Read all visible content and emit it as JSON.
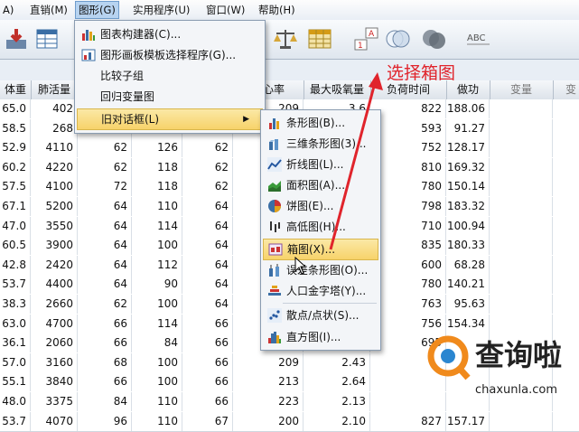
{
  "menubar": {
    "items": [
      "A)",
      "直销(M)",
      "图形(G)",
      "实用程序(U)",
      "窗口(W)",
      "帮助(H)"
    ]
  },
  "toolbar": {
    "icons": [
      "import-data-icon",
      "spreadsheet-icon",
      "scale-icon",
      "grid-icon",
      "vector-icon",
      "circles-icon",
      "circles-dark-icon",
      "abc-icon"
    ]
  },
  "graph_menu": {
    "items": [
      "图表构建器(C)...",
      "图形画板模板选择程序(G)...",
      "比较子组",
      "回归变量图",
      "旧对话框(L)"
    ]
  },
  "legacy_submenu": {
    "items": [
      "条形图(B)...",
      "三维条形图(3)...",
      "折线图(L)...",
      "面积图(A)...",
      "饼图(E)...",
      "高低图(H)...",
      "箱图(X)...",
      "误差条形图(O)...",
      "人口金字塔(Y)...",
      "散点/点状(S)...",
      "直方图(I)..."
    ]
  },
  "grid": {
    "headers": [
      "体重",
      "肺活量",
      "",
      "",
      "",
      "大心率",
      "最大吸氧量",
      "负荷时间",
      "做功",
      "变量",
      "变"
    ],
    "rows": [
      [
        "65.0",
        "402",
        "",
        "",
        "",
        "209",
        "3.6",
        "822",
        "188.06"
      ],
      [
        "58.5",
        "268",
        "",
        "",
        "",
        "",
        "",
        "593",
        "91.27"
      ],
      [
        "52.9",
        "4110",
        "62",
        "126",
        "62",
        "",
        "",
        "752",
        "128.17"
      ],
      [
        "60.2",
        "4220",
        "62",
        "118",
        "62",
        "",
        "",
        "810",
        "169.32"
      ],
      [
        "57.5",
        "4100",
        "72",
        "118",
        "62",
        "",
        "",
        "780",
        "150.14"
      ],
      [
        "67.1",
        "5200",
        "64",
        "110",
        "64",
        "",
        "",
        "798",
        "183.32"
      ],
      [
        "47.0",
        "3550",
        "64",
        "114",
        "64",
        "",
        "",
        "710",
        "100.94"
      ],
      [
        "60.5",
        "3900",
        "64",
        "100",
        "64",
        "",
        "",
        "835",
        "180.33"
      ],
      [
        "42.8",
        "2420",
        "64",
        "112",
        "64",
        "",
        "",
        "600",
        "68.28"
      ],
      [
        "53.7",
        "4400",
        "64",
        "90",
        "64",
        "",
        "",
        "780",
        "140.21"
      ],
      [
        "38.3",
        "2660",
        "62",
        "100",
        "64",
        "",
        "",
        "763",
        "95.63"
      ],
      [
        "63.0",
        "4700",
        "66",
        "114",
        "66",
        "",
        "",
        "756",
        "154.34"
      ],
      [
        "36.1",
        "2060",
        "66",
        "84",
        "66",
        "",
        "",
        "695",
        ""
      ],
      [
        "57.0",
        "3160",
        "68",
        "100",
        "66",
        "209",
        "2.43",
        "",
        ""
      ],
      [
        "55.1",
        "3840",
        "66",
        "100",
        "66",
        "213",
        "2.64",
        "",
        ""
      ],
      [
        "48.0",
        "3375",
        "84",
        "110",
        "66",
        "223",
        "2.13",
        "",
        ""
      ],
      [
        "53.7",
        "4070",
        "96",
        "110",
        "67",
        "200",
        "2.10",
        "827",
        "157.17"
      ]
    ]
  },
  "annotation": {
    "text": "选择箱图",
    "color": "#e0242c"
  },
  "watermark": {
    "title": "查询啦",
    "domain": "chaxunla.com"
  }
}
